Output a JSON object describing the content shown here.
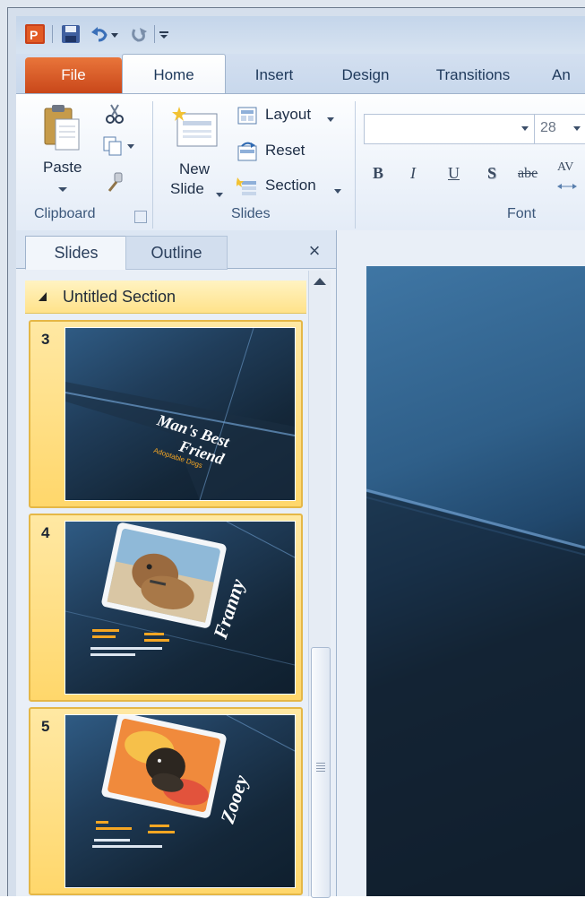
{
  "app": {
    "name": "PowerPoint",
    "app_icon": "powerpoint-icon",
    "quick_access": [
      "save-icon",
      "undo-icon",
      "undo-dropdown-icon",
      "redo-icon",
      "customize-qat-icon"
    ]
  },
  "ribbon_tabs": [
    "File",
    "Home",
    "Insert",
    "Design",
    "Transitions",
    "An"
  ],
  "ribbon": {
    "clipboard": {
      "paste": "Paste",
      "label": "Clipboard"
    },
    "slides": {
      "new_slide_line1": "New",
      "new_slide_line2": "Slide",
      "layout": "Layout",
      "reset": "Reset",
      "section": "Section",
      "label": "Slides"
    },
    "font": {
      "font_name": "",
      "font_size": "28",
      "bold": "B",
      "italic": "I",
      "underline": "U",
      "shadow": "S",
      "strikethrough": "abe",
      "spacing": "AV",
      "label": "Font"
    }
  },
  "pane": {
    "tabs": [
      "Slides",
      "Outline"
    ],
    "close": "×",
    "section_title": "Untitled Section",
    "slides": [
      {
        "number": "3",
        "title_line1": "Man's Best",
        "title_line2": "Friend",
        "subtitle": "Adoptable Dogs"
      },
      {
        "number": "4",
        "name": "Franny",
        "photo": "brown dog on beach"
      },
      {
        "number": "5",
        "name": "Zooey",
        "photo": "black dog on orange blanket"
      }
    ]
  },
  "colors": {
    "file_tab": "#d6541f",
    "section_bar": "#ffe28a",
    "slide_dark": "#142739",
    "slide_accent": "#f5a623"
  }
}
